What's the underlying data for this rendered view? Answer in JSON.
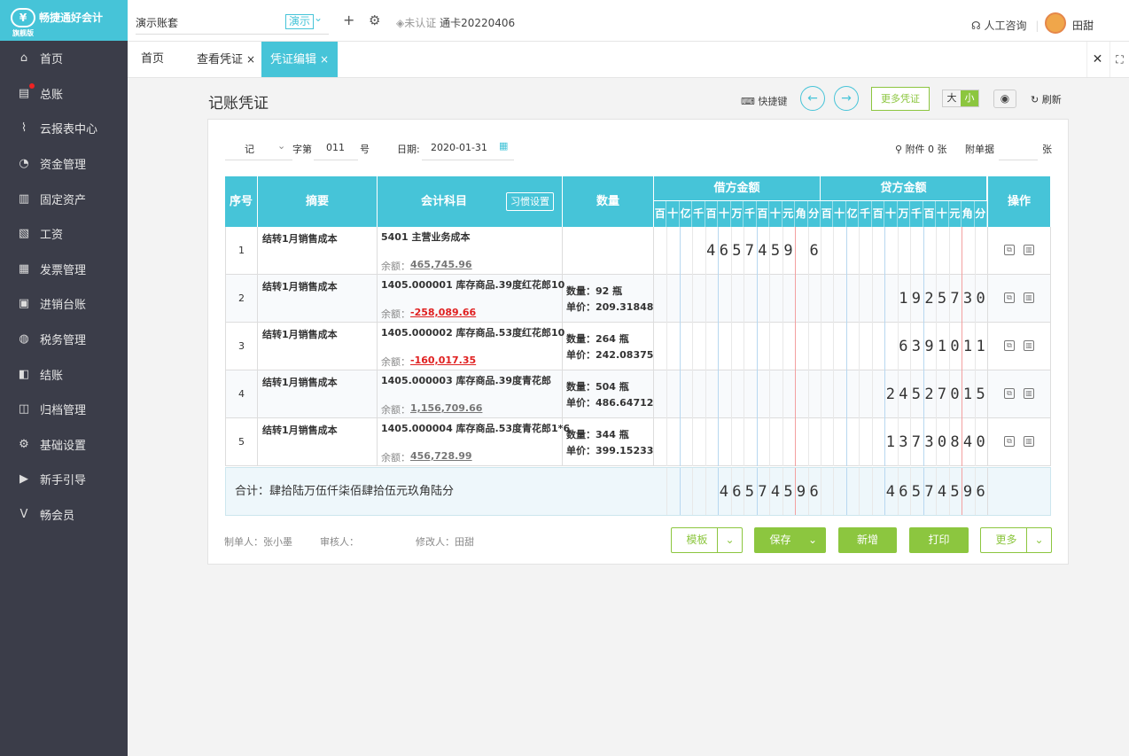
{
  "sidebar": {
    "logo_name": "畅捷通好会计",
    "logo_edition": "旗舰版",
    "items": [
      {
        "label": "首页",
        "icon": "home-icon",
        "glyph": "⌂"
      },
      {
        "label": "总账",
        "icon": "ledger-icon",
        "glyph": "▤",
        "dot": true
      },
      {
        "label": "云报表中心",
        "icon": "chart-icon",
        "glyph": "⌇"
      },
      {
        "label": "资金管理",
        "icon": "money-bag-icon",
        "glyph": "◔"
      },
      {
        "label": "固定资产",
        "icon": "building-icon",
        "glyph": "▥"
      },
      {
        "label": "工资",
        "icon": "salary-icon",
        "glyph": "▧"
      },
      {
        "label": "发票管理",
        "icon": "invoice-icon",
        "glyph": "▦"
      },
      {
        "label": "进销台账",
        "icon": "inventory-icon",
        "glyph": "▣"
      },
      {
        "label": "税务管理",
        "icon": "tax-icon",
        "glyph": "◍"
      },
      {
        "label": "结账",
        "icon": "checkout-icon",
        "glyph": "◧"
      },
      {
        "label": "归档管理",
        "icon": "archive-icon",
        "glyph": "◫"
      },
      {
        "label": "基础设置",
        "icon": "settings-icon",
        "glyph": "⚙"
      },
      {
        "label": "新手引导",
        "icon": "guide-icon",
        "glyph": "▶"
      },
      {
        "label": "畅会员",
        "icon": "vip-icon",
        "glyph": "V"
      }
    ]
  },
  "header": {
    "account": "演示账套",
    "demo_tag": "演示",
    "cert_status": "未认证",
    "card_name": "通卡20220406",
    "service": "人工咨询",
    "user": "田甜"
  },
  "tabs": {
    "items": [
      {
        "label": "首页",
        "closable": false
      },
      {
        "label": "查看凭证",
        "closable": true
      },
      {
        "label": "凭证编辑",
        "closable": true,
        "active": true
      }
    ]
  },
  "page": {
    "title": "记账凭证",
    "hotkey": "快捷键",
    "more_voucher": "更多凭证",
    "size_big": "大",
    "size_small": "小",
    "refresh": "刷新"
  },
  "voucher": {
    "word": "记",
    "word_label": "字第",
    "number": "011",
    "number_suffix": "号",
    "date_label": "日期:",
    "date": "2020-01-31",
    "attach_label": "附件 0 张",
    "doc_label": "附单据",
    "doc_suffix": "张"
  },
  "table": {
    "headers": {
      "seq": "序号",
      "summary": "摘要",
      "account": "会计科目",
      "habit": "习惯设置",
      "quantity": "数量",
      "debit": "借方金额",
      "credit": "贷方金额",
      "ops": "操作"
    },
    "digit_units": [
      "百",
      "十",
      "亿",
      "千",
      "百",
      "十",
      "万",
      "千",
      "百",
      "十",
      "元",
      "角",
      "分"
    ],
    "rows": [
      {
        "seq": "1",
        "summary": "结转1月销售成本",
        "account": "5401 主营业务成本",
        "balance_label": "余额：",
        "balance": "465,745.96",
        "negative": false,
        "qty": "",
        "price": "",
        "debit": "4657459 6",
        "credit": ""
      },
      {
        "seq": "2",
        "summary": "结转1月销售成本",
        "account": "1405.000001 库存商品.39度红花郎10",
        "balance_label": "余额：",
        "balance": "-258,089.66",
        "negative": true,
        "qty": "数量：92 瓶",
        "price": "单价：209.31848",
        "debit": "",
        "credit": "1925730"
      },
      {
        "seq": "3",
        "summary": "结转1月销售成本",
        "account": "1405.000002 库存商品.53度红花郎10",
        "balance_label": "余额：",
        "balance": "-160,017.35",
        "negative": true,
        "qty": "数量：264 瓶",
        "price": "单价：242.08375",
        "debit": "",
        "credit": "6391011"
      },
      {
        "seq": "4",
        "summary": "结转1月销售成本",
        "account": "1405.000003 库存商品.39度青花郎",
        "balance_label": "余额：",
        "balance": "1,156,709.66",
        "negative": false,
        "qty": "数量：504 瓶",
        "price": "单价：486.64712",
        "debit": "",
        "credit": "24527015"
      },
      {
        "seq": "5",
        "summary": "结转1月销售成本",
        "account": "1405.000004 库存商品.53度青花郎1*6",
        "balance_label": "余额：",
        "balance": "456,728.99",
        "negative": false,
        "qty": "数量：344 瓶",
        "price": "单价：399.15233",
        "debit": "",
        "credit": "13730840"
      }
    ],
    "total_label": "合计：肆拾陆万伍仟柒佰肆拾伍元玖角陆分",
    "total_debit": "46574596",
    "total_credit": "46574596"
  },
  "footer": {
    "maker": "制单人：张小墨",
    "auditor": "审核人：",
    "modifier": "修改人：田甜",
    "template": "模板",
    "save": "保存",
    "add": "新增",
    "print": "打印",
    "more": "更多"
  }
}
